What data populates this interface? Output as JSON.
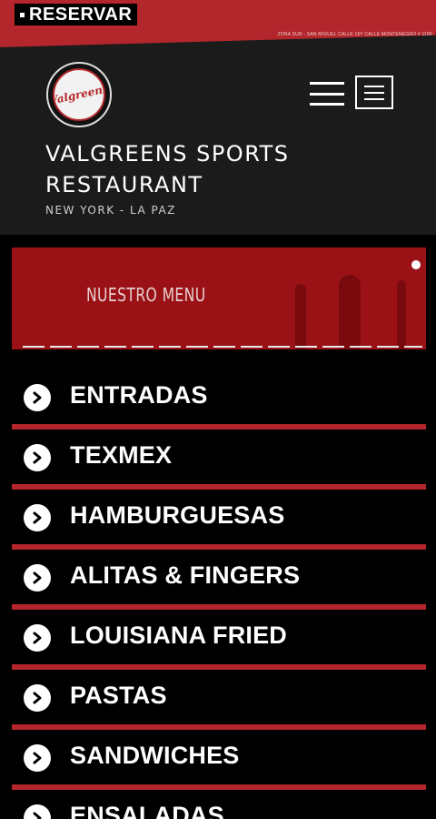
{
  "topbar": {
    "reserve_label": "RESERVAR",
    "address": "ZONA SUR - SAN MIGUEL CALLE 16Y CALLE MONTENEGRO # 1186"
  },
  "header": {
    "logo_text": "Valgreens",
    "title": "VALGREENS SPORTS RESTAURANT",
    "subtitle": "NEW YORK - LA PAZ"
  },
  "banner": {
    "title": "NUESTRO MENU"
  },
  "menu": {
    "items": [
      {
        "label": "ENTRADAS"
      },
      {
        "label": "TEXMEX"
      },
      {
        "label": "HAMBURGUESAS"
      },
      {
        "label": "ALITAS & FINGERS"
      },
      {
        "label": "LOUISIANA FRIED"
      },
      {
        "label": "PASTAS"
      },
      {
        "label": "SANDWICHES"
      },
      {
        "label": "ENSALADAS"
      }
    ]
  },
  "colors": {
    "accent_red": "#b3262b",
    "banner_red": "#9a1116",
    "header_bg": "#1b1b1b",
    "page_bg": "#000000"
  },
  "icons": {
    "menu_item_icon": "chevron-right-circle-icon",
    "nav_icon": "hamburger-icon",
    "menu_box_icon": "menu-box-icon"
  }
}
